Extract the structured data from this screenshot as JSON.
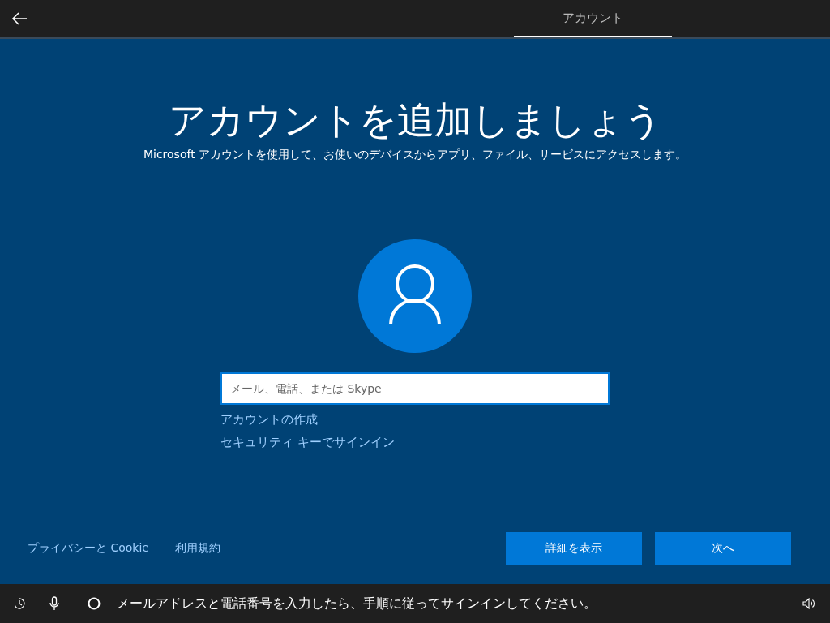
{
  "header": {
    "tabs": [
      {
        "label": "アカウント",
        "selected": true
      }
    ]
  },
  "title": "アカウントを追加しましょう",
  "subtitle": "Microsoft アカウントを使用して、お使いのデバイスからアプリ、ファイル、サービスにアクセスします。",
  "account_field": {
    "placeholder": "メール、電話、または Skype"
  },
  "links": [
    "アカウントの作成",
    "セキュリティ キーでサインイン"
  ],
  "footer_links": [
    "プライバシーと Cookie",
    "利用規約"
  ],
  "buttons": [
    "詳細を表示",
    "次へ"
  ],
  "status_bar": {
    "message": "メールアドレスと電話番号を入力したら、手順に従ってサインインしてください。"
  }
}
